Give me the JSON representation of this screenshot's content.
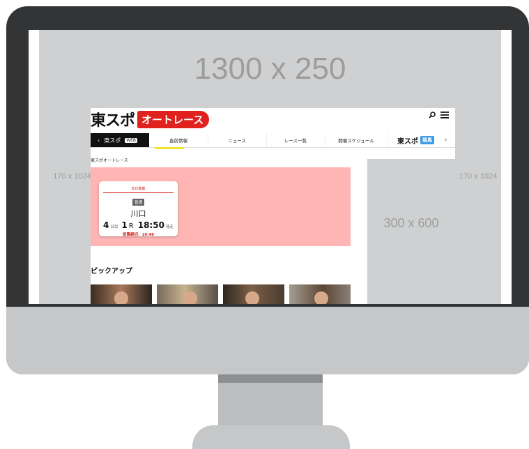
{
  "ads": {
    "top_banner": "1300 x 250",
    "left_rail": "170 x 1024",
    "right_rail": "170 x 1024",
    "side_rect": "300 x 600"
  },
  "site": {
    "logo_main": "東スポ",
    "logo_sub": "オートレース",
    "nav": {
      "back_label": "東スポ",
      "back_badge": "WEB",
      "items": [
        "直前情報",
        "ニュース",
        "レース一覧",
        "開催スケジュール"
      ],
      "brand_label": "東スポ",
      "brand_badge": "競馬"
    },
    "breadcrumb": "東スポオートレース",
    "race_card": {
      "status": "本日開催",
      "grade": "普通",
      "venue": "川口",
      "day_number": "4",
      "day_unit": "日目",
      "race_number": "1",
      "race_unit": "R",
      "start_time": "18:50",
      "start_label": "発走",
      "close_label": "投票締切：18:48"
    },
    "pickup_title": "ピックアップ"
  },
  "colors": {
    "accent_red": "#e0211d",
    "hero_pink": "#ffb5b3",
    "nav_underline": "#f1e52b",
    "brand_blue": "#3d9be5"
  }
}
